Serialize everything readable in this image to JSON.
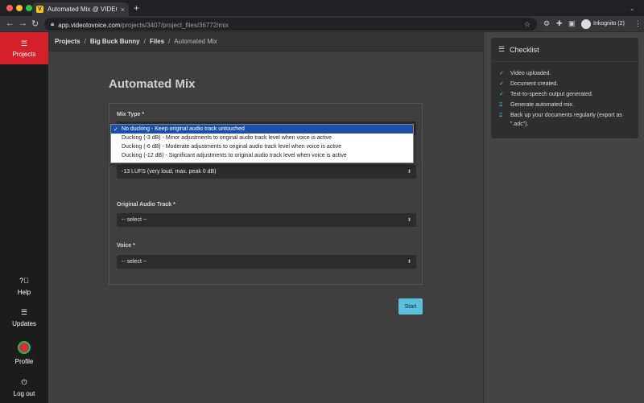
{
  "browser": {
    "tab_title": "Automated Mix @ VIDEO TO V",
    "favicon_letter": "V",
    "url_host": "app.videotovoice.com",
    "url_path": "/projects/3407/project_files/36772/mix",
    "profile_label": "Inkognito (2)"
  },
  "sidebar": {
    "projects_label": "Projects",
    "help_label": "Help",
    "updates_label": "Updates",
    "profile_label": "Profile",
    "logout_label": "Log out"
  },
  "breadcrumb": {
    "items": [
      "Projects",
      "Big Buck Bunny",
      "Files"
    ],
    "current": "Automated Mix",
    "separator": "/"
  },
  "main": {
    "title": "Automated Mix",
    "mix_type_label": "Mix Type *",
    "mix_type_options": [
      "No ducking - Keep original audio track untouched",
      "Ducking (-3 dB) - Minor adjustments to original audio track level when voice is active",
      "Ducking (-6 dB) - Moderate adjustments to original audio track level when voice is active",
      "Ducking (-12 dB) - Significant adjustments to original audio track level when voice is active"
    ],
    "mix_type_selected_check": "✓",
    "loudness_value": "-13 LUFS (very loud, max. peak 0 dB)",
    "original_track_label": "Original Audio Track *",
    "original_track_value": "-- select --",
    "voice_label": "Voice *",
    "voice_value": "-- select --",
    "start_label": "Start"
  },
  "checklist": {
    "title": "Checklist",
    "items": [
      "Video uploaded.",
      "Document created.",
      "Text-to-speech output generated.",
      "Generate automated mix.",
      "Back up your documents regularly (export as \".adc\")."
    ],
    "done_count_note": "",
    "colors": {
      "done": "#3cb54a",
      "todo": "#4aa3d8",
      "accent": "#d3202a",
      "start_button": "#5bc0de"
    }
  }
}
